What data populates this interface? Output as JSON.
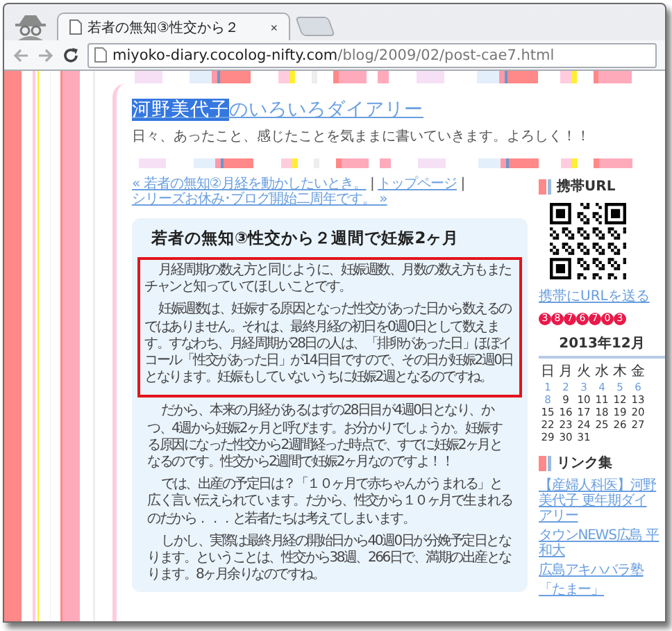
{
  "browser": {
    "tab_title": "若者の無知③性交から２",
    "tab_close": "×",
    "url_host": "miyoko-diary.cocolog-nifty.com",
    "url_path": "/blog/2009/02/post-cae7.html"
  },
  "blog": {
    "title_parts": [
      {
        "text": "河野美代子",
        "selected": true
      },
      {
        "text": "のいろいろダイアリー",
        "selected": false
      }
    ],
    "description": "日々、あったこと、感じたことを気ままに書いていきます。よろしく！！"
  },
  "nav": [
    {
      "kind": "link",
      "text": "« 若者の無知②月経を動かしたいとき。"
    },
    {
      "kind": "separator",
      "text": "|"
    },
    {
      "kind": "link",
      "text": "トップページ"
    },
    {
      "kind": "separator",
      "text": "|"
    },
    {
      "kind": "link",
      "text": "シリーズお休み･ブログ開始二周年です。 »"
    }
  ],
  "article": {
    "title": "若者の無知③性交から２週間で妊娠2ヶ月",
    "paragraphs": [
      {
        "highlighted": true,
        "text": "月経周期の数え方と同じように、妊娠週数、月数の数え方もまたチャンと知っていてほしいことです。"
      },
      {
        "highlighted": true,
        "text": "妊娠週数は、妊娠する原因となった性交があった日から数えるのではありません。それは、最終月経の初日を0週0日として数えます。すなわち、月経周期が28日の人は、「排卵があった日」ほぼイコール「性交があった日」が14日目ですので、その日が妊娠2週0日となります。妊娠もしていないうちに妊娠2週となるのですね。"
      },
      {
        "highlighted": false,
        "text": "だから、本来の月経があるはずの28日目が4週0日となり、かつ、4週から妊娠2ヶ月と呼びます。お分かりでしょうか。妊娠する原因になった性交から2週間経った時点で、すでに妊娠2ヶ月となるのです。性交から2週間で妊娠2ヶ月なのですよ！！"
      },
      {
        "highlighted": false,
        "text": "では、出産の予定日は？「１０ヶ月で赤ちゃんがうまれる」と広く言い伝えられています。だから、性交から１０ヶ月で生まれるのだから．．．と若者たちは考えてしまいます。"
      },
      {
        "highlighted": false,
        "text": "しかし、実際は最終月経の開始日から40週0日が分娩予定日となります。ということは、性交から38週、266日で、満期の出産となります。8ヶ月余りなのですね。"
      }
    ]
  },
  "sidebar": {
    "mobile_heading": "携帯URL",
    "mobile_link": "携帯にURLを送る",
    "counter_digits": [
      "3",
      "8",
      "7",
      "6",
      "7",
      "0",
      "3"
    ],
    "calendar": {
      "title": "2013年12月",
      "weekdays": [
        "日",
        "月",
        "火",
        "水",
        "木",
        "金"
      ],
      "weeks": [
        [
          {
            "day": "1",
            "linked": true
          },
          {
            "day": "2",
            "linked": true
          },
          {
            "day": "3",
            "linked": true
          },
          {
            "day": "4",
            "linked": true
          },
          {
            "day": "5",
            "linked": true
          },
          {
            "day": "6",
            "linked": true
          }
        ],
        [
          {
            "day": "8",
            "linked": true
          },
          {
            "day": "9",
            "linked": false
          },
          {
            "day": "10",
            "linked": false
          },
          {
            "day": "11",
            "linked": false
          },
          {
            "day": "12",
            "linked": false
          },
          {
            "day": "13",
            "linked": false
          }
        ],
        [
          {
            "day": "15",
            "linked": false
          },
          {
            "day": "16",
            "linked": false
          },
          {
            "day": "17",
            "linked": false
          },
          {
            "day": "18",
            "linked": false
          },
          {
            "day": "19",
            "linked": false
          },
          {
            "day": "20",
            "linked": false
          }
        ],
        [
          {
            "day": "22",
            "linked": false
          },
          {
            "day": "23",
            "linked": false
          },
          {
            "day": "24",
            "linked": false
          },
          {
            "day": "25",
            "linked": false
          },
          {
            "day": "26",
            "linked": false
          },
          {
            "day": "27",
            "linked": false
          }
        ],
        [
          {
            "day": "29",
            "linked": false
          },
          {
            "day": "30",
            "linked": false
          },
          {
            "day": "31",
            "linked": false
          }
        ]
      ]
    },
    "links_heading": "リンク集",
    "links": [
      "【産婦人科医】河野美代子 更年期ダイアリー",
      "タウンNEWS広島 平和大",
      "広島アキハバラ塾",
      "「たまー」"
    ]
  }
}
